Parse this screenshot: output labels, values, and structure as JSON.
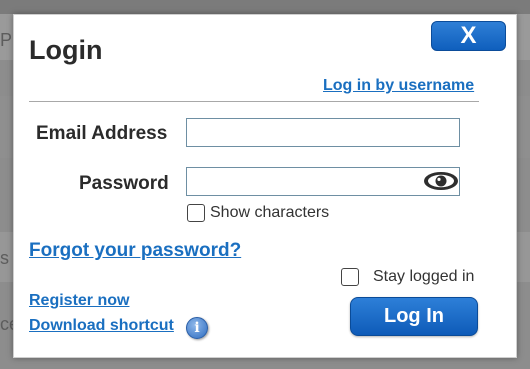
{
  "background": {
    "fragment_top": "PE",
    "fragment_mid": "s",
    "fragment_low": "ce"
  },
  "dialog": {
    "close_label": "X",
    "title": "Login",
    "username_link": "Log in by username",
    "email_label": "Email Address",
    "email_value": "",
    "password_label": "Password",
    "password_value": "",
    "show_characters_label": "Show characters",
    "show_characters_checked": false,
    "forgot_password_link": "Forgot your password?",
    "stay_logged_in_label": "Stay logged in",
    "stay_logged_in_checked": false,
    "register_link": "Register now",
    "download_link": "Download shortcut",
    "info_icon_glyph": "i",
    "login_button": "Log In"
  },
  "icons": {
    "close": "close-icon",
    "eye": "eye-icon",
    "info": "info-icon"
  },
  "colors": {
    "accent": "#1a6fc0",
    "button": "#1565c0",
    "overlay": "#8d8d8d"
  }
}
